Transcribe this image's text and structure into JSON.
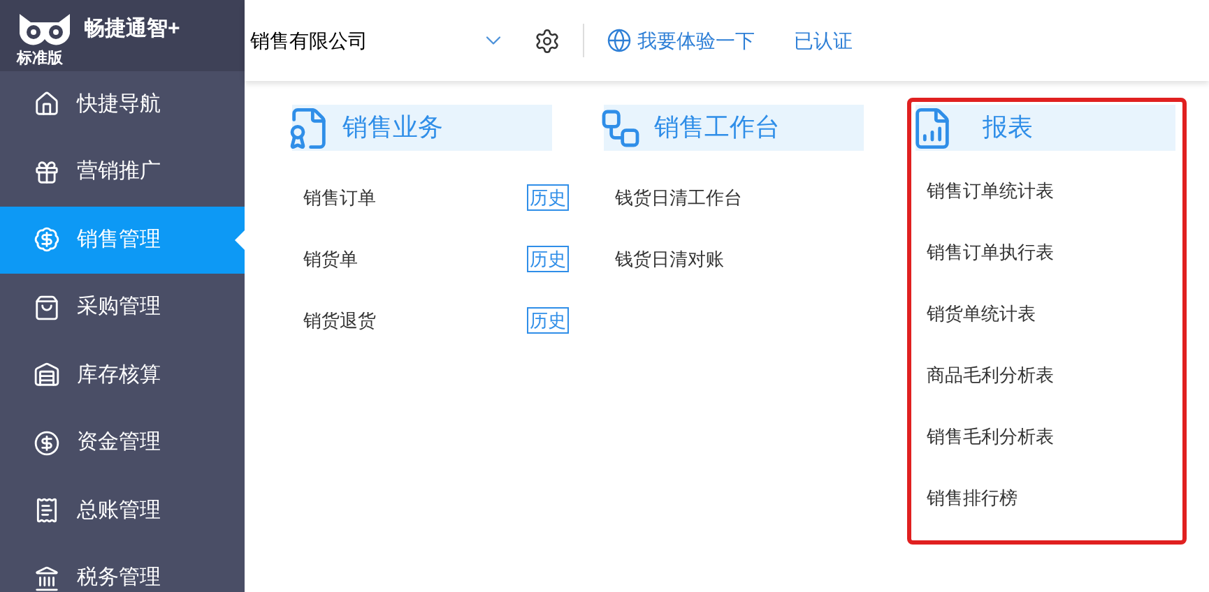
{
  "brand": {
    "name": "畅捷通智+",
    "edition": "标准版"
  },
  "topbar": {
    "company": "销售有限公司",
    "trial_link": "我要体验一下",
    "certified": "已认证"
  },
  "sidebar": {
    "items": [
      {
        "label": "快捷导航",
        "selected": false
      },
      {
        "label": "营销推广",
        "selected": false
      },
      {
        "label": "销售管理",
        "selected": true
      },
      {
        "label": "采购管理",
        "selected": false
      },
      {
        "label": "库存核算",
        "selected": false
      },
      {
        "label": "资金管理",
        "selected": false
      },
      {
        "label": "总账管理",
        "selected": false
      },
      {
        "label": "税务管理",
        "selected": false
      }
    ]
  },
  "sections": [
    {
      "title": "销售业务",
      "highlighted": false,
      "items": [
        {
          "label": "销售订单",
          "history": "历史"
        },
        {
          "label": "销货单",
          "history": "历史"
        },
        {
          "label": "销货退货",
          "history": "历史"
        }
      ]
    },
    {
      "title": "销售工作台",
      "highlighted": false,
      "items": [
        {
          "label": "钱货日清工作台"
        },
        {
          "label": "钱货日清对账"
        }
      ]
    },
    {
      "title": "报表",
      "highlighted": true,
      "items": [
        {
          "label": "销售订单统计表"
        },
        {
          "label": "销售订单执行表"
        },
        {
          "label": "销货单统计表"
        },
        {
          "label": "商品毛利分析表"
        },
        {
          "label": "销售毛利分析表"
        },
        {
          "label": "销售排行榜"
        }
      ]
    }
  ]
}
